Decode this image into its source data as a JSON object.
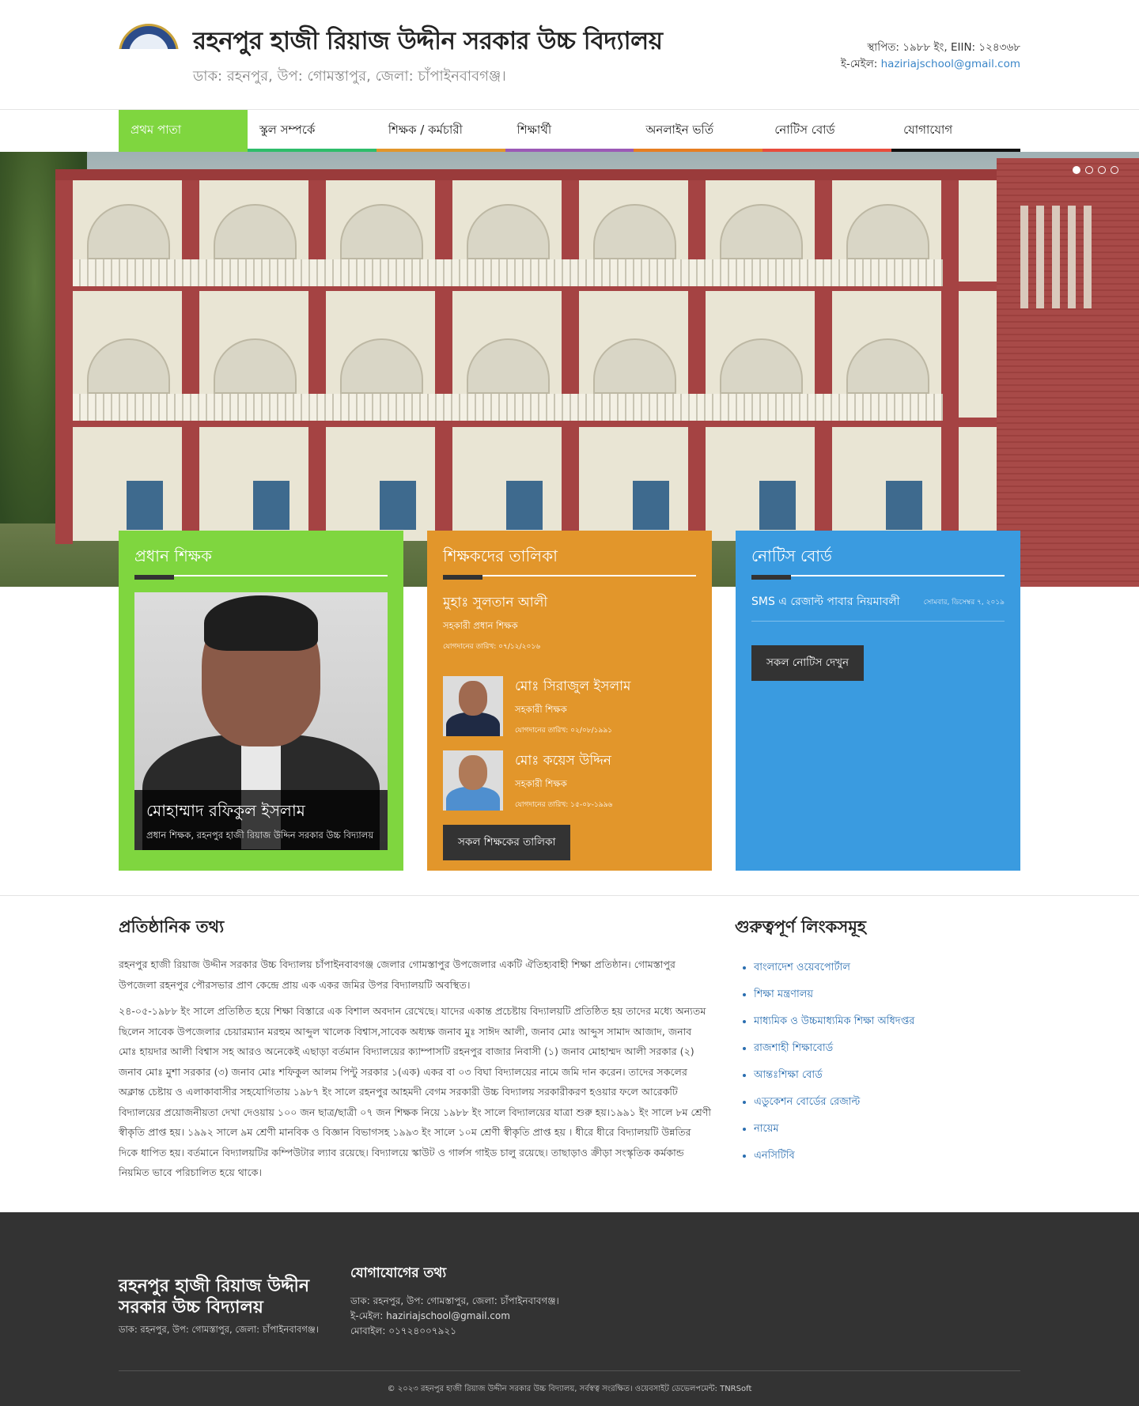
{
  "header": {
    "title": "রহনপুর হাজী রিয়াজ উদ্দীন সরকার উচ্চ বিদ্যালয়",
    "address": "ডাক: রহনপুর, উপ: গোমস্তাপুর, জেলা: চাঁপাইনবাবগঞ্জ।",
    "established": "স্থাপিত: ১৯৮৮ ইং, EIIN: ১২৪৩৬৮",
    "email_label": "ই-মেইল:",
    "email": "haziriajschool@gmail.com"
  },
  "nav": {
    "items": [
      {
        "label": "প্রথম পাতা",
        "color": "#7fd63f"
      },
      {
        "label": "স্কুল সম্পর্কে",
        "color": "#2ebd6b"
      },
      {
        "label": "শিক্ষক / কর্মচারী",
        "color": "#e2962b"
      },
      {
        "label": "শিক্ষার্থী",
        "color": "#9b59b6"
      },
      {
        "label": "অনলাইন ভর্তি",
        "color": "#e67e22"
      },
      {
        "label": "নোটিস বোর্ড",
        "color": "#e74c3c"
      },
      {
        "label": "যোগাযোগ",
        "color": "#111111"
      }
    ]
  },
  "slider": {
    "slides": 4,
    "active": 1
  },
  "headmaster": {
    "heading": "প্রধান শিক্ষক",
    "name": "মোহাম্মাদ রফিকুল ইসলাম",
    "role": "প্রধান শিক্ষক, রহনপুর হাজী রিয়াজ উদ্দিন সরকার উচ্চ বিদ্যালয়"
  },
  "teachers": {
    "heading": "শিক্ষকদের তালিকা",
    "featured": {
      "name": "মুহাঃ সুলতান আলী",
      "role": "সহকারী প্রধান শিক্ষক",
      "joined": "যোগদানের তারিখ: ০৭/১২/২০১৬"
    },
    "list": [
      {
        "name": "মোঃ সিরাজুল ইসলাম",
        "role": "সহকারী শিক্ষক",
        "joined": "যোগদানের তারিখ: ০২/০৮/১৯৯১"
      },
      {
        "name": "মোঃ কয়েস উদ্দিন",
        "role": "সহকারী শিক্ষক",
        "joined": "যোগদানের তারিখ: ১৫-০৮-১৯৯৬"
      }
    ],
    "button": "সকল শিক্ষকের তালিকা"
  },
  "notice": {
    "heading": "নোটিস বোর্ড",
    "items": [
      {
        "title": "SMS এ রেজাল্ট পাবার নিয়মাবলী",
        "date": "সোমবার, ডিসেম্বর ৭, ২০১৯"
      }
    ],
    "button": "সকল নোটিস দেখুন"
  },
  "info": {
    "heading": "প্রতিষ্ঠানিক তথ্য",
    "paragraphs": [
      "রহনপুর হাজী রিয়াজ উদ্দীন সরকার উচ্চ বিদ্যালয় চাঁপাইনবাবগঞ্জ জেলার গোমস্তাপুর উপজেলার একটি ঐতিহ্যবাহী শিক্ষা প্রতিষ্ঠান। গোমস্তাপুর উপজেলা রহনপুর পৌরসভার প্রাণ কেন্দ্রে প্রায় এক একর জমির উপর বিদ্যালয়টি অবস্থিত।",
      "২৪-০৫-১৯৮৮ ইং সালে প্রতিষ্ঠিত হয়ে শিক্ষা বিস্তারে এক বিশাল অবদান রেখেছে। যাদের একান্ত প্রচেষ্টায় বিদ্যালয়টি প্রতিষ্ঠিত হয় তাদের মধ্যে অন্যতম ছিলেন সাবেক উপজেলার চেয়ারম্যান মরহুম আব্দুল খালেক বিশ্বাস,সাবেক অধ্যক্ষ জনাব মুঃ সাঈদ আলী, জনাব মোঃ আব্দুস সামাদ আজাদ, জনাব মোঃ হায়দার আলী বিশ্বাস সহ আরও অনেকেই এছাড়া বর্তমান বিদ্যালয়ের ক্যাম্পাসটি রহনপুর বাজার নিবাসী (১) জনাব মোহাম্মদ আলী সরকার (২) জনাব মোঃ মুশা সরকার (৩) জনাব মোঃ শফিকুল আলম পিন্টু সরকার ১(এক) একর বা ০৩ বিঘা বিদ্যালয়ের নামে জমি দান করেন। তাদের সকলের অক্লান্ত চেষ্টায় ও এলাকাবাসীর সহযোগিতায় ১৯৮৭ ইং সালে রহনপুর আহমদী বেগম সরকারী উচ্চ বিদ্যালয় সরকারীকরণ হওয়ার ফলে আরেকটি বিদ্যালয়ের প্রয়োজনীয়তা দেখা দেওয়ায় ১০০ জন ছাত্র/ছাত্রী ০৭ জন শিক্ষক নিয়ে ১৯৮৮ ইং সালে বিদ্যালয়ের যাত্রা শুরু হয়।১৯৯১ ইং সালে ৮ম শ্রেণী স্বীকৃতি প্রাপ্ত হয়। ১৯৯২ সালে ৯ম শ্রেণী মানবিক ও বিজ্ঞান বিভাগসহ ১৯৯৩ ইং সালে ১০ম শ্রেণী স্বীকৃতি প্রাপ্ত হয় । ধীরে ধীরে বিদ্যালয়টি উন্নতির দিকে ধাপিত হয়। বর্তমানে বিদ্যালয়টির কম্পিউটার ল্যাব রয়েছে। বিদ্যালয়ে স্কাউট ও গার্লস গাইড চালু রয়েছে। তাছাড়াও ক্রীড়া সংস্কৃতিক কর্মকান্ড নিয়মিত ভাবে পরিচালিত হয়ে থাকে।"
    ]
  },
  "links": {
    "heading": "গুরুত্বপূর্ণ লিংকসমূহ",
    "items": [
      "বাংলাদেশ ওয়েবপোর্টাল",
      "শিক্ষা মন্ত্রণালয়",
      "মাধ্যমিক ও উচ্চমাধ্যমিক শিক্ষা অধিদপ্তর",
      "রাজশাহী শিক্ষাবোর্ড",
      "আন্তঃশিক্ষা বোর্ড",
      "এডুকেশন বোর্ডের রেজাল্ট",
      "নায়েম",
      "এনসিটিবি"
    ]
  },
  "footer": {
    "name": "রহনপুর হাজী রিয়াজ উদ্দীন সরকার উচ্চ বিদ্যালয়",
    "address": "ডাক: রহনপুর, উপ: গোমস্তাপুর, জেলা: চাঁপাইনবাবগঞ্জ।",
    "contact_heading": "যোগাযোগের তথ্য",
    "contact_address": "ডাক: রহনপুর, উপ: গোমস্তাপুর, জেলা: চাঁপাইনবাবগঞ্জ।",
    "contact_email": "ই-মেইল: haziriajschool@gmail.com",
    "contact_mobile": "মোবাইল: ০১৭২৪০০৭৯২১",
    "copyright": "© ২০২৩ রহনপুর হাজী রিয়াজ উদ্দীন সরকার উচ্চ বিদ্যালয়, সর্বস্বত্ব সংরক্ষিত। ওয়েবসাইট ডেভেলপমেন্ট: TNRSoft"
  },
  "colors": {
    "headmaster_panel": "#7fd63f",
    "teachers_panel": "#e2962b",
    "notice_panel": "#3a9be0",
    "link": "#2a6eb0",
    "footer_bg": "#333333"
  }
}
